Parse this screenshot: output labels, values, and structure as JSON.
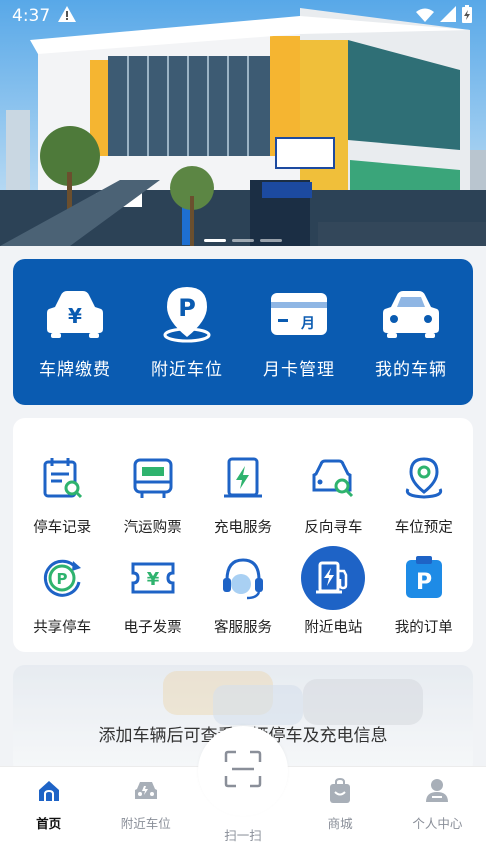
{
  "status_bar": {
    "time": "4:37"
  },
  "quick_actions": [
    {
      "label": "车牌缴费",
      "icon": "car-yuan-icon"
    },
    {
      "label": "附近车位",
      "icon": "parking-pin-icon"
    },
    {
      "label": "月卡管理",
      "icon": "month-card-icon"
    },
    {
      "label": "我的车辆",
      "icon": "my-car-icon"
    }
  ],
  "services": [
    {
      "label": "停车记录",
      "icon": "parking-record-icon"
    },
    {
      "label": "汽运购票",
      "icon": "bus-ticket-icon"
    },
    {
      "label": "充电服务",
      "icon": "charging-service-icon"
    },
    {
      "label": "反向寻车",
      "icon": "find-car-icon"
    },
    {
      "label": "车位预定",
      "icon": "space-booking-icon"
    },
    {
      "label": "共享停车",
      "icon": "shared-parking-icon"
    },
    {
      "label": "电子发票",
      "icon": "e-invoice-icon"
    },
    {
      "label": "客服服务",
      "icon": "customer-service-icon"
    },
    {
      "label": "附近电站",
      "icon": "nearby-station-icon"
    },
    {
      "label": "我的订单",
      "icon": "my-orders-icon"
    }
  ],
  "promo": {
    "text": "添加车辆后可查看车辆停车及充电信息"
  },
  "nav": [
    {
      "label": "首页",
      "icon": "home-icon",
      "active": true
    },
    {
      "label": "附近车位",
      "icon": "nearby-parking-icon",
      "active": false
    },
    {
      "label": "扫一扫",
      "icon": "scan-icon",
      "active": false
    },
    {
      "label": "商城",
      "icon": "mall-icon",
      "active": false
    },
    {
      "label": "个人中心",
      "icon": "profile-icon",
      "active": false
    }
  ],
  "colors": {
    "brand_blue": "#0a5bb1",
    "icon_blue": "#1e63c6",
    "icon_green": "#2fb36e"
  }
}
